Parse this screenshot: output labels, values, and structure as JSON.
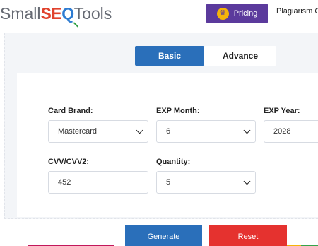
{
  "header": {
    "logo": {
      "part1": "Small",
      "part2": "SE",
      "part3": "Q",
      "part4": "Tools"
    },
    "pricing_label": "Pricing",
    "pricing_icon": "crown-icon",
    "nav_link": "Plagiarism Ch"
  },
  "tabs": [
    {
      "label": "Basic",
      "active": true
    },
    {
      "label": "Advance",
      "active": false
    }
  ],
  "form": {
    "card_brand": {
      "label": "Card Brand:",
      "value": "Mastercard"
    },
    "exp_month": {
      "label": "EXP Month:",
      "value": "6"
    },
    "exp_year": {
      "label": "EXP Year:",
      "value": "2028"
    },
    "cvv": {
      "label": "CVV/CVV2:",
      "value": "452"
    },
    "quantity": {
      "label": "Quantity:",
      "value": "5"
    }
  },
  "buttons": {
    "generate": "Generate",
    "reset": "Reset"
  },
  "colors": {
    "brand_purple": "#5b3a9c",
    "primary_blue": "#2a6fba",
    "reset_red": "#e5322f",
    "logo_red": "#e0422d",
    "logo_blue": "#2d7bd1"
  }
}
